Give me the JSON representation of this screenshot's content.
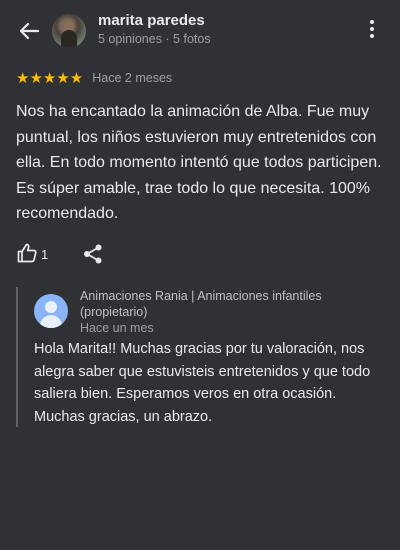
{
  "reviewer": {
    "name": "marita paredes",
    "meta": "5 opiniones · 5 fotos"
  },
  "review": {
    "stars": "★★★★★",
    "rating": 5,
    "when": "Hace 2 meses",
    "text": "Nos ha encantado la animación de Alba. Fue muy puntual, los niños estuvieron muy entretenidos con ella. En todo momento intentó que todos participen. Es súper amable, trae todo lo que necesita. 100% recomendado.",
    "like_count": "1"
  },
  "owner_reply": {
    "name": "Animaciones Rania | Animaciones infantiles (propietario)",
    "when": "Hace un mes",
    "text": "Hola Marita!! Muchas gracias por tu valoración, nos alegra saber que estuvisteis entretenidos y que todo saliera bien. Esperamos veros en otra ocasión. Muchas gracias, un abrazo."
  },
  "icons": {
    "back": "arrow-back-icon",
    "more": "more-vert-icon",
    "like": "thumb-up-icon",
    "share": "share-icon"
  },
  "colors": {
    "background": "#303134",
    "star": "#fbbc04",
    "owner_avatar": "#8ab4f8"
  }
}
